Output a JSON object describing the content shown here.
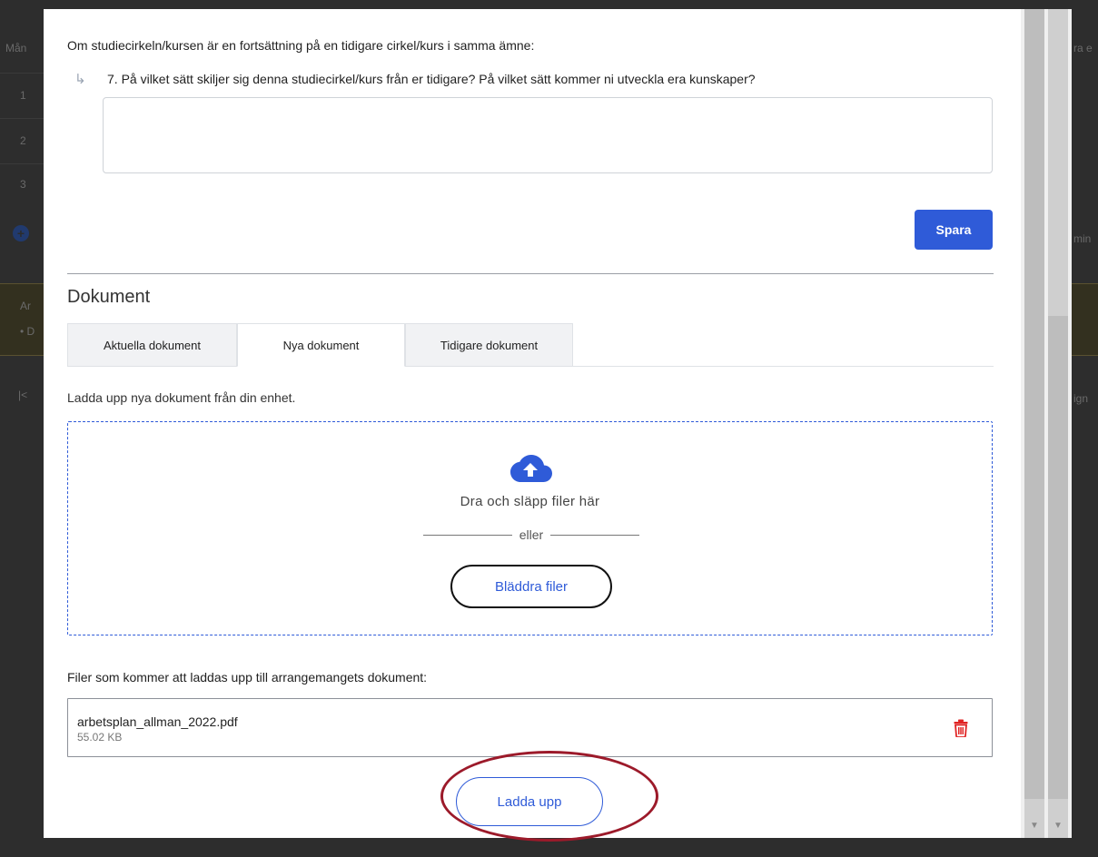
{
  "background": {
    "left_cells": [
      "Mån",
      "1",
      "2",
      "3",
      "Ar",
      "• D",
      "|<"
    ],
    "right_cells": [
      "ra e",
      "min",
      "ign"
    ]
  },
  "form": {
    "intro": "Om studiecirkeln/kursen är en fortsättning på en tidigare cirkel/kurs i samma ämne:",
    "question": "7. På vilket sätt skiljer sig denna studiecirkel/kurs från er tidigare? På vilket sätt kommer ni utveckla era kunskaper?",
    "answer_value": "",
    "save_label": "Spara"
  },
  "documents": {
    "title": "Dokument",
    "tabs": [
      {
        "label": "Aktuella dokument",
        "active": false
      },
      {
        "label": "Nya dokument",
        "active": true
      },
      {
        "label": "Tidigare dokument",
        "active": false
      }
    ],
    "upload_hint": "Ladda upp nya dokument från din enhet.",
    "dropzone": {
      "text": "Dra och släpp filer här",
      "or_text": "eller",
      "browse_label": "Bläddra filer",
      "icon": "cloud-upload-icon"
    },
    "files_caption": "Filer som kommer att laddas upp till arrangemangets dokument:",
    "files": [
      {
        "name": "arbetsplan_allman_2022.pdf",
        "size": "55.02 KB"
      }
    ],
    "upload_label": "Ladda upp"
  },
  "colors": {
    "accent": "#2f5bd8",
    "delete": "#e02424",
    "highlight_ring": "#9c1a2a"
  }
}
